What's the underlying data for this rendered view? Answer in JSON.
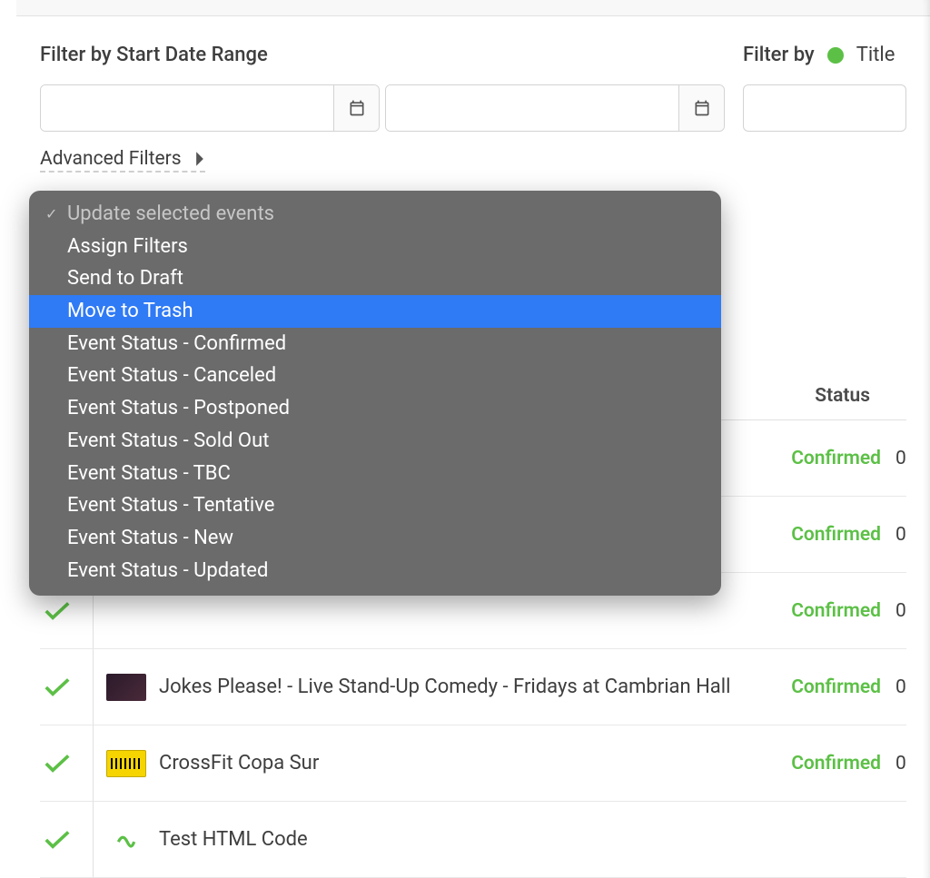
{
  "filters": {
    "date_range_label": "Filter by Start Date Range",
    "filter_by_label": "Filter by",
    "title_label": "Title",
    "advanced_label": "Advanced Filters"
  },
  "dropdown": {
    "items": [
      {
        "label": "Update selected events",
        "current": true,
        "highlight": false
      },
      {
        "label": "Assign Filters",
        "current": false,
        "highlight": false
      },
      {
        "label": "Send to Draft",
        "current": false,
        "highlight": false
      },
      {
        "label": "Move to Trash",
        "current": false,
        "highlight": true
      },
      {
        "label": "Event Status - Confirmed",
        "current": false,
        "highlight": false
      },
      {
        "label": "Event Status - Canceled",
        "current": false,
        "highlight": false
      },
      {
        "label": "Event Status - Postponed",
        "current": false,
        "highlight": false
      },
      {
        "label": "Event Status - Sold Out",
        "current": false,
        "highlight": false
      },
      {
        "label": "Event Status - TBC",
        "current": false,
        "highlight": false
      },
      {
        "label": "Event Status - Tentative",
        "current": false,
        "highlight": false
      },
      {
        "label": "Event Status - New",
        "current": false,
        "highlight": false
      },
      {
        "label": "Event Status - Updated",
        "current": false,
        "highlight": false
      }
    ]
  },
  "table": {
    "status_header": "Status",
    "rows": [
      {
        "title": "",
        "status": "Confirmed",
        "extra": "0"
      },
      {
        "title": "",
        "status": "Confirmed",
        "extra": "0"
      },
      {
        "title": "",
        "status": "Confirmed",
        "extra": "0"
      },
      {
        "title": "Jokes Please! - Live Stand-Up Comedy - Fridays at Cambrian Hall",
        "status": "Confirmed",
        "extra": "0"
      },
      {
        "title": "CrossFit Copa Sur",
        "status": "Confirmed",
        "extra": "0"
      },
      {
        "title": "Test HTML Code",
        "status": "",
        "extra": ""
      }
    ]
  },
  "colors": {
    "accent_green": "#5cc046",
    "highlight_blue": "#2f7af5"
  }
}
